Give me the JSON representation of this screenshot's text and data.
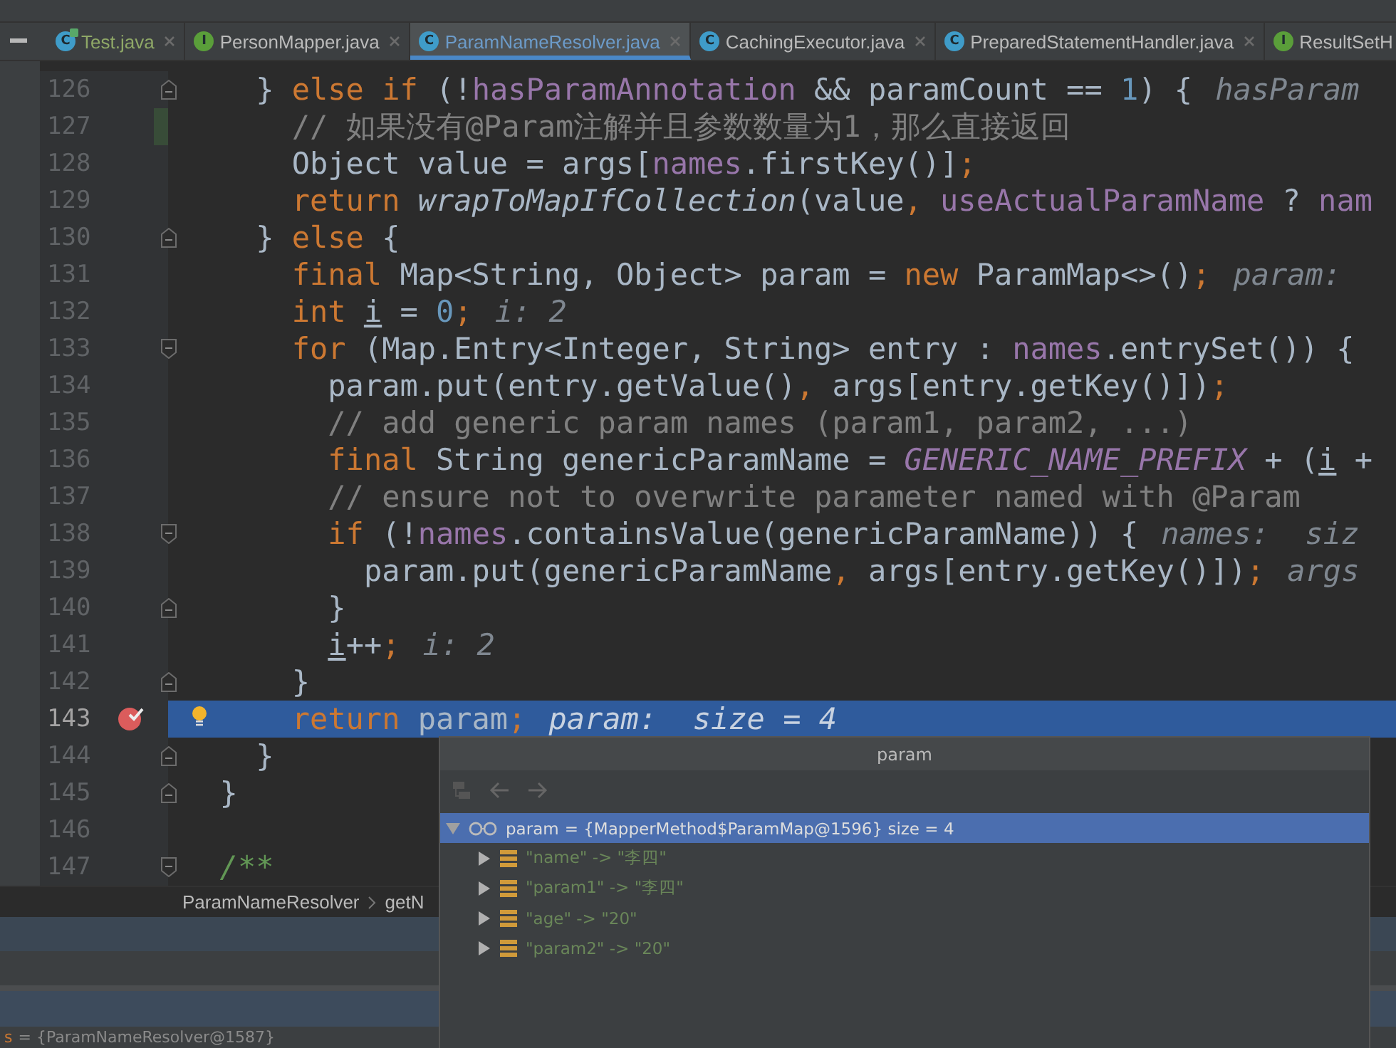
{
  "tabs": [
    {
      "label": "Test.java",
      "icon": {
        "letter": "C",
        "color": "#3f9cc9"
      },
      "runnable": true,
      "color": "#8fa867",
      "selected": false
    },
    {
      "label": "PersonMapper.java",
      "icon": {
        "letter": "I",
        "color": "#5a9e3a"
      },
      "runnable": false,
      "color": "#bbbbbb",
      "selected": false
    },
    {
      "label": "ParamNameResolver.java",
      "icon": {
        "letter": "C",
        "color": "#3f9cc9"
      },
      "runnable": false,
      "color": "#6c9bc9",
      "selected": true
    },
    {
      "label": "CachingExecutor.java",
      "icon": {
        "letter": "C",
        "color": "#3f9cc9"
      },
      "runnable": false,
      "color": "#bbbbbb",
      "selected": false
    },
    {
      "label": "PreparedStatementHandler.java",
      "icon": {
        "letter": "C",
        "color": "#3f9cc9"
      },
      "runnable": false,
      "color": "#bbbbbb",
      "selected": false
    },
    {
      "label": "ResultSetH",
      "icon": {
        "letter": "I",
        "color": "#5a9e3a"
      },
      "runnable": false,
      "color": "#bbbbbb",
      "selected": false
    }
  ],
  "editor": {
    "lines": [
      {
        "number": "126",
        "fold_end": true,
        "tokens": [
          {
            "t": "    } ",
            "kind": "plain"
          },
          {
            "t": "else if",
            "kind": "keyword"
          },
          {
            "t": " (!",
            "kind": "plain"
          },
          {
            "t": "hasParamAnnotation",
            "kind": "field"
          },
          {
            "t": " && paramCount == ",
            "kind": "plain"
          },
          {
            "t": "1",
            "kind": "number"
          },
          {
            "t": ") {",
            "kind": "plain"
          }
        ],
        "hint": "hasParam"
      },
      {
        "number": "127",
        "changed": true,
        "tokens": [
          {
            "t": "      // 如果没有@Param注解并且参数数量为1，那么直接返回",
            "kind": "comment"
          }
        ]
      },
      {
        "number": "128",
        "tokens": [
          {
            "t": "      Object value = args[",
            "kind": "plain"
          },
          {
            "t": "names",
            "kind": "field"
          },
          {
            "t": ".firstKey()]",
            "kind": "plain"
          },
          {
            "t": ";",
            "kind": "keyword"
          }
        ]
      },
      {
        "number": "129",
        "tokens": [
          {
            "t": "      return",
            "kind": "keyword"
          },
          {
            "t": " wrapToMapIfCollection",
            "kind": "static_call"
          },
          {
            "t": "(value",
            "kind": "plain"
          },
          {
            "t": ",",
            "kind": "keyword"
          },
          {
            "t": " useActualParamName",
            "kind": "field"
          },
          {
            "t": " ? ",
            "kind": "plain"
          },
          {
            "t": "nam",
            "kind": "field"
          }
        ]
      },
      {
        "number": "130",
        "fold_end": true,
        "tokens": [
          {
            "t": "    } ",
            "kind": "plain"
          },
          {
            "t": "else",
            "kind": "keyword"
          },
          {
            "t": " {",
            "kind": "plain"
          }
        ]
      },
      {
        "number": "131",
        "tokens": [
          {
            "t": "      final",
            "kind": "keyword"
          },
          {
            "t": " Map<String, Object> param = ",
            "kind": "plain"
          },
          {
            "t": "new",
            "kind": "keyword"
          },
          {
            "t": " ParamMap<>()",
            "kind": "plain"
          },
          {
            "t": ";",
            "kind": "keyword"
          }
        ],
        "hint": "param:"
      },
      {
        "number": "132",
        "tokens": [
          {
            "t": "      int ",
            "kind": "keyword"
          },
          {
            "t": "i",
            "kind": "reassigned"
          },
          {
            "t": " = ",
            "kind": "plain"
          },
          {
            "t": "0",
            "kind": "number"
          },
          {
            "t": ";",
            "kind": "keyword"
          }
        ],
        "hint": "i: 2"
      },
      {
        "number": "133",
        "fold_start": true,
        "tokens": [
          {
            "t": "      for",
            "kind": "keyword"
          },
          {
            "t": " (Map.Entry<Integer, String> entry : ",
            "kind": "plain"
          },
          {
            "t": "names",
            "kind": "field"
          },
          {
            "t": ".entrySet()) {",
            "kind": "plain"
          }
        ]
      },
      {
        "number": "134",
        "tokens": [
          {
            "t": "        param.put(entry.getValue()",
            "kind": "plain"
          },
          {
            "t": ",",
            "kind": "keyword"
          },
          {
            "t": " args[entry.getKey()])",
            "kind": "plain"
          },
          {
            "t": ";",
            "kind": "keyword"
          }
        ]
      },
      {
        "number": "135",
        "tokens": [
          {
            "t": "        // add generic param names (param1, param2, ...)",
            "kind": "comment"
          }
        ]
      },
      {
        "number": "136",
        "tokens": [
          {
            "t": "        final",
            "kind": "keyword"
          },
          {
            "t": " String genericParamName = ",
            "kind": "plain"
          },
          {
            "t": "GENERIC_NAME_PREFIX",
            "kind": "constant"
          },
          {
            "t": " + (",
            "kind": "plain"
          },
          {
            "t": "i",
            "kind": "reassigned"
          },
          {
            "t": " +",
            "kind": "plain"
          }
        ]
      },
      {
        "number": "137",
        "tokens": [
          {
            "t": "        // ensure not to overwrite parameter named with @Param",
            "kind": "comment"
          }
        ]
      },
      {
        "number": "138",
        "fold_start": true,
        "tokens": [
          {
            "t": "        if",
            "kind": "keyword"
          },
          {
            "t": " (!",
            "kind": "plain"
          },
          {
            "t": "names",
            "kind": "field"
          },
          {
            "t": ".containsValue(genericParamName)) {",
            "kind": "plain"
          }
        ],
        "hint": "names:  siz"
      },
      {
        "number": "139",
        "tokens": [
          {
            "t": "          param.put(genericParamName",
            "kind": "plain"
          },
          {
            "t": ",",
            "kind": "keyword"
          },
          {
            "t": " args[entry.getKey()])",
            "kind": "plain"
          },
          {
            "t": ";",
            "kind": "keyword"
          }
        ],
        "hint": "args"
      },
      {
        "number": "140",
        "fold_end": true,
        "tokens": [
          {
            "t": "        }",
            "kind": "plain"
          }
        ]
      },
      {
        "number": "141",
        "tokens": [
          {
            "t": "        i",
            "kind": "reassigned"
          },
          {
            "t": "++",
            "kind": "plain"
          },
          {
            "t": ";",
            "kind": "keyword"
          }
        ],
        "hint": "i: 2"
      },
      {
        "number": "142",
        "fold_end": true,
        "tokens": [
          {
            "t": "      }",
            "kind": "plain"
          }
        ]
      },
      {
        "number": "143",
        "breakpoint": true,
        "current": true,
        "intention": true,
        "tokens": [
          {
            "t": "      return",
            "kind": "keyword"
          },
          {
            "t": " param",
            "kind": "plain"
          },
          {
            "t": ";",
            "kind": "keyword"
          }
        ],
        "hint": "param:  size = 4"
      },
      {
        "number": "144",
        "fold_end": true,
        "tokens": [
          {
            "t": "    }",
            "kind": "plain"
          }
        ]
      },
      {
        "number": "145",
        "fold_end": true,
        "tokens": [
          {
            "t": "  }",
            "kind": "plain"
          }
        ]
      },
      {
        "number": "146"
      },
      {
        "number": "147",
        "fold_start": true,
        "tokens": [
          {
            "t": "  /**",
            "kind": "doc"
          }
        ]
      }
    ]
  },
  "breadcrumb": [
    "ParamNameResolver",
    "getN"
  ],
  "variable_row": {
    "name": "s",
    "value": "= {ParamNameResolver@1587}"
  },
  "popup": {
    "title": "param",
    "tree": [
      {
        "name": "param",
        "value": "= {MapperMethod$ParamMap@1596}  size = 4",
        "kind": "watch",
        "expanded": true,
        "selected": true,
        "children": [
          {
            "name": "\"name\" -> \"李四\"",
            "kind": "entry",
            "expanded": false,
            "selected": false
          },
          {
            "name": "\"param1\" -> \"李四\"",
            "kind": "entry",
            "expanded": false,
            "selected": false
          },
          {
            "name": "\"age\" -> \"20\"",
            "kind": "entry",
            "expanded": false,
            "selected": false
          },
          {
            "name": "\"param2\" -> \"20\"",
            "kind": "entry",
            "expanded": false,
            "selected": false
          }
        ]
      }
    ]
  }
}
